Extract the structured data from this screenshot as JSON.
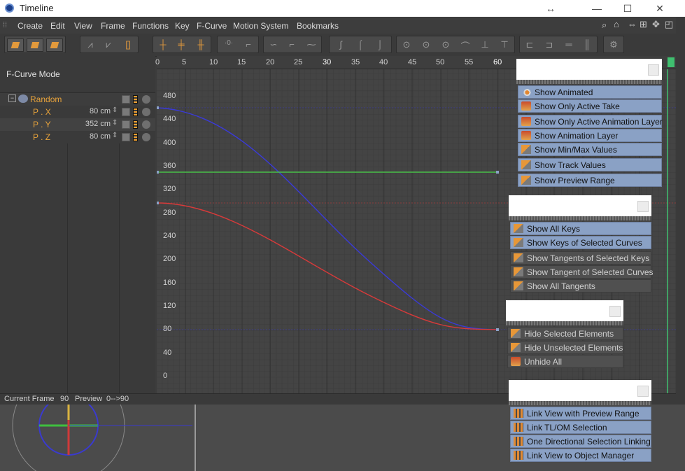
{
  "window": {
    "title": "Timeline"
  },
  "menubar": [
    "Create",
    "Edit",
    "View",
    "Frame",
    "Functions",
    "Key",
    "F-Curve",
    "Motion System",
    "Bookmarks"
  ],
  "left_panel": {
    "mode_label": "F-Curve Mode",
    "object": {
      "name": "Random"
    },
    "tracks": [
      {
        "name": "P . X",
        "value": "80 cm"
      },
      {
        "name": "P . Y",
        "value": "352 cm"
      },
      {
        "name": "P . Z",
        "value": "80 cm"
      }
    ]
  },
  "graph": {
    "frame_ticks": [
      "0",
      "5",
      "10",
      "15",
      "20",
      "25",
      "30",
      "35",
      "40",
      "45",
      "50",
      "55",
      "60"
    ],
    "value_ticks": [
      "480",
      "440",
      "400",
      "360",
      "320",
      "280",
      "240",
      "200",
      "160",
      "120",
      "80",
      "40",
      "0"
    ],
    "colors": {
      "x_curve": "#3a3ad8",
      "y_curve": "#4bc24b",
      "z_curve": "#d83a3a",
      "grid": "#3a3a3a"
    }
  },
  "status": {
    "current_frame_label": "Current Frame",
    "current_frame": "90",
    "preview_label": "Preview",
    "preview_range": "0-->90"
  },
  "popups": {
    "show_group": {
      "items": [
        {
          "label": "Show Animated",
          "state": "active",
          "icon": "eye-icon"
        },
        {
          "label": "Show Only Active Take",
          "state": "active",
          "icon": "take-icon"
        },
        {
          "label": "Show Only Active Animation Layer",
          "state": "active",
          "icon": "layer-icon"
        },
        {
          "label": "Show Animation Layer",
          "state": "active",
          "icon": "layer-icon"
        },
        {
          "label": "Show Min/Max Values",
          "state": "active",
          "icon": "minmax-icon"
        },
        {
          "label": "Show Track Values",
          "state": "active",
          "icon": "track-icon"
        },
        {
          "label": "Show Preview Range",
          "state": "active",
          "icon": "preview-icon"
        }
      ]
    },
    "keys_group": {
      "items": [
        {
          "label": "Show All Keys",
          "state": "active",
          "icon": "keys-icon"
        },
        {
          "label": "Show Keys of Selected Curves",
          "state": "active",
          "icon": "keys-icon"
        },
        {
          "label": "Show Tangents of Selected Keys",
          "state": "inactive",
          "icon": "tangent-icon"
        },
        {
          "label": "Show Tangent of Selected Curves",
          "state": "inactive",
          "icon": "tangent-icon"
        },
        {
          "label": "Show All Tangents",
          "state": "inactive",
          "icon": "tangent-icon"
        }
      ]
    },
    "hide_group": {
      "items": [
        {
          "label": "Hide Selected Elements",
          "state": "inactive",
          "icon": "hide-icon"
        },
        {
          "label": "Hide Unselected Elements",
          "state": "inactive",
          "icon": "hide-icon"
        },
        {
          "label": "Unhide All",
          "state": "inactive",
          "icon": "unhide-icon"
        }
      ]
    },
    "link_group": {
      "items": [
        {
          "label": "Link View with Preview Range",
          "state": "active",
          "icon": "link-icon"
        },
        {
          "label": "Link TL/OM Selection",
          "state": "active",
          "icon": "link-icon"
        },
        {
          "label": "One Directional Selection Linking",
          "state": "active",
          "icon": "link-icon"
        },
        {
          "label": "Link View to Object Manager",
          "state": "active",
          "icon": "link-icon"
        }
      ]
    }
  }
}
